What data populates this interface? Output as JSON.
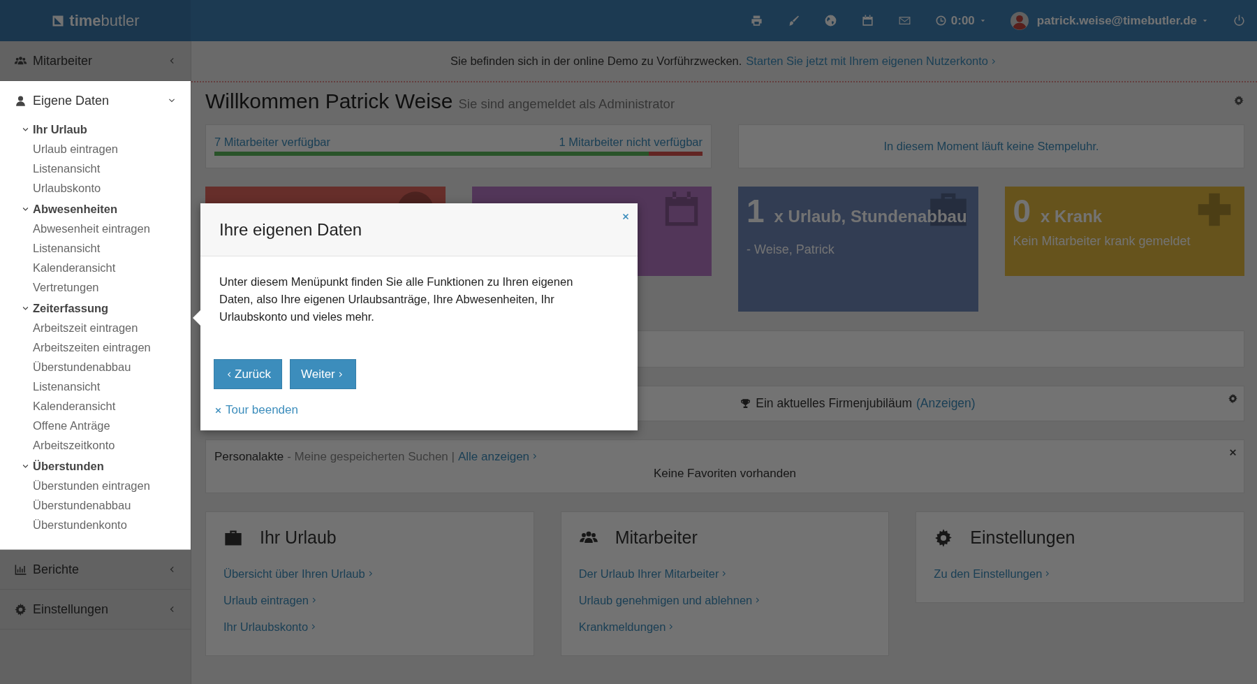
{
  "topbar": {
    "logo": "**time**butler",
    "timer": "0:00",
    "user": "patrick.weise@timebutler.de"
  },
  "banner": {
    "text": "Sie befinden sich in der online Demo zu Vorführzwecken.",
    "link": "Starten Sie jetzt mit Ihrem eigenen Nutzerkonto"
  },
  "sidebar": [
    {
      "label": "Mitarbeiter",
      "expanded": false,
      "highlighted": false
    },
    {
      "label": "Eigene Daten",
      "expanded": true,
      "highlighted": true,
      "groups": [
        {
          "label": "Ihr Urlaub",
          "expanded": true,
          "items": [
            "Urlaub eintragen",
            "Listenansicht",
            "Urlaubskonto"
          ]
        },
        {
          "label": "Abwesenheiten",
          "expanded": true,
          "items": [
            "Abwesenheit eintragen",
            "Listenansicht",
            "Kalenderansicht",
            "Vertretungen"
          ]
        },
        {
          "label": "Zeiterfassung",
          "expanded": true,
          "items": [
            "Arbeitszeit eintragen",
            "Arbeitszeiten eintragen",
            "Überstundenabbau",
            "Listenansicht",
            "Kalenderansicht",
            "Offene Anträge",
            "Arbeitszeitkonto"
          ]
        },
        {
          "label": "Überstunden",
          "expanded": true,
          "items": [
            "Überstunden eintragen",
            "Überstundenabbau",
            "Überstundenkonto"
          ]
        }
      ]
    },
    {
      "label": "Berichte",
      "expanded": false,
      "highlighted": false
    },
    {
      "label": "Einstellungen",
      "expanded": false,
      "highlighted": false
    }
  ],
  "welcome": {
    "title": "Willkommen Patrick Weise",
    "subtitle": "Sie sind angemeldet als Administrator"
  },
  "availability": {
    "available": "7 Mitarbeiter verfügbar",
    "unavailable": "1 Mitarbeiter nicht verfügbar",
    "level": 0.89
  },
  "stempeluhr": "In diesem Moment läuft keine Stempeluhr.",
  "stat_cards": [
    {
      "kind": "absence"
    },
    {
      "kind": "appointment"
    },
    {
      "kind": "vacation",
      "count": "1",
      "title": "x Urlaub, Stundenabbau",
      "detail": "- Weise, Patrick"
    },
    {
      "kind": "sick",
      "count": "0",
      "title": "x Krank",
      "detail": "Kein Mitarbeiter krank gemeldet"
    }
  ],
  "jubilee": {
    "text": "Ein aktuelles Firmenjubiläum",
    "link": "(Anzeigen)"
  },
  "personalakte": {
    "label": "Personalakte",
    "sublabel": "- Meine gespeicherten Suchen |",
    "link": "Alle anzeigen",
    "empty": "Keine Favoriten vorhanden"
  },
  "link_cards": [
    {
      "title": "Ihr Urlaub",
      "links": [
        "Übersicht über Ihren Urlaub",
        "Urlaub eintragen",
        "Ihr Urlaubskonto"
      ]
    },
    {
      "title": "Mitarbeiter",
      "links": [
        "Der Urlaub Ihrer Mitarbeiter",
        "Urlaub genehmigen und ablehnen",
        "Krankmeldungen"
      ]
    },
    {
      "title": "Einstellungen",
      "links": [
        "Zu den Einstellungen"
      ]
    }
  ],
  "tour": {
    "title": "Ihre eigenen Daten",
    "body": "Unter diesem Menüpunkt finden Sie alle Funktionen zu Ihren eigenen Daten, also Ihre eigenen Urlaubsanträge, Ihre Abwesenheiten, Ihr Urlaubskonto und vieles mehr.",
    "back": "Zurück",
    "next": "Weiter",
    "end": "Tour beenden"
  }
}
